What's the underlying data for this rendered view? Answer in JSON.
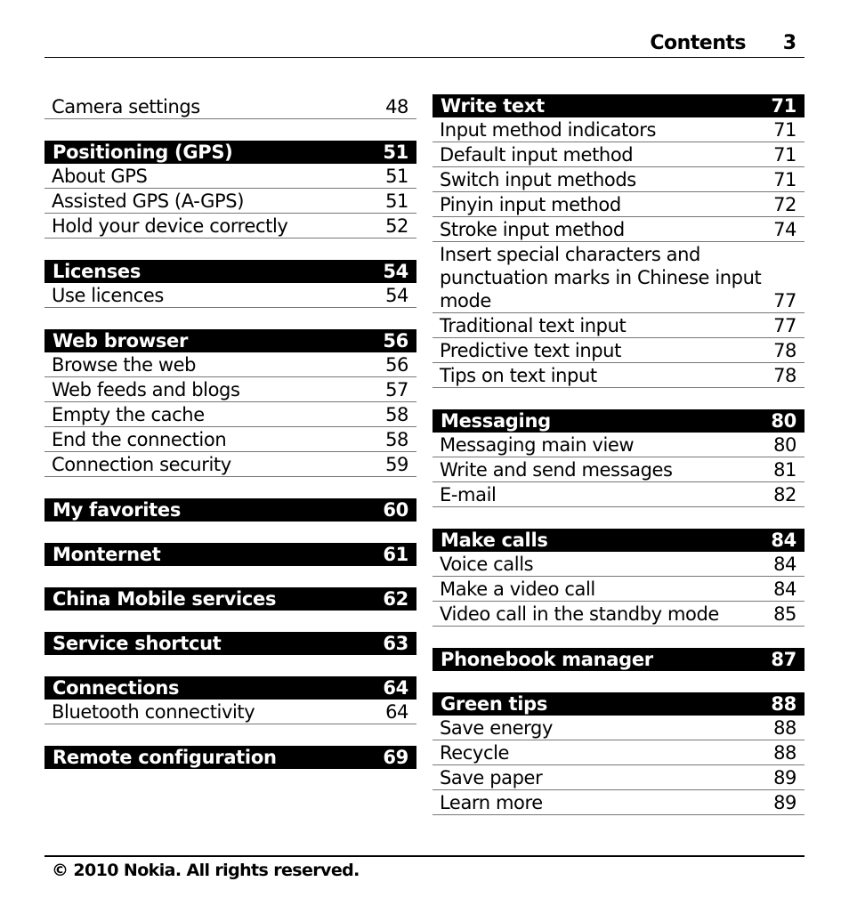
{
  "header": {
    "title": "Contents",
    "page": "3"
  },
  "left": [
    {
      "heading": null,
      "entries": [
        {
          "label": "Camera settings",
          "page": "48"
        }
      ]
    },
    {
      "heading": {
        "label": "Positioning (GPS)",
        "page": "51"
      },
      "entries": [
        {
          "label": "About GPS",
          "page": "51"
        },
        {
          "label": "Assisted GPS (A-GPS)",
          "page": "51"
        },
        {
          "label": "Hold your device correctly",
          "page": "52"
        }
      ]
    },
    {
      "heading": {
        "label": "Licenses",
        "page": "54"
      },
      "entries": [
        {
          "label": "Use licences",
          "page": "54"
        }
      ]
    },
    {
      "heading": {
        "label": "Web browser",
        "page": "56"
      },
      "entries": [
        {
          "label": "Browse the web",
          "page": "56"
        },
        {
          "label": "Web feeds and blogs",
          "page": "57"
        },
        {
          "label": "Empty the cache",
          "page": "58"
        },
        {
          "label": "End the connection",
          "page": "58"
        },
        {
          "label": "Connection security",
          "page": "59"
        }
      ]
    },
    {
      "heading": {
        "label": "My favorites",
        "page": "60"
      },
      "entries": []
    },
    {
      "heading": {
        "label": "Monternet",
        "page": "61"
      },
      "entries": []
    },
    {
      "heading": {
        "label": "China Mobile services",
        "page": "62"
      },
      "entries": []
    },
    {
      "heading": {
        "label": "Service shortcut",
        "page": "63"
      },
      "entries": []
    },
    {
      "heading": {
        "label": "Connections",
        "page": "64"
      },
      "entries": [
        {
          "label": "Bluetooth connectivity",
          "page": "64"
        }
      ]
    },
    {
      "heading": {
        "label": "Remote configuration",
        "page": "69"
      },
      "entries": []
    }
  ],
  "right": [
    {
      "heading": {
        "label": "Write text",
        "page": "71"
      },
      "entries": [
        {
          "label": "Input method indicators",
          "page": "71"
        },
        {
          "label": "Default input method",
          "page": "71"
        },
        {
          "label": "Switch input methods",
          "page": "71"
        },
        {
          "label": "Pinyin input method",
          "page": "72"
        },
        {
          "label": "Stroke input method",
          "page": "74"
        },
        {
          "label": "Insert special characters and punctuation marks in Chinese input mode",
          "page": "77"
        },
        {
          "label": "Traditional text input",
          "page": "77"
        },
        {
          "label": "Predictive text input",
          "page": "78"
        },
        {
          "label": "Tips on text input",
          "page": "78"
        }
      ]
    },
    {
      "heading": {
        "label": "Messaging",
        "page": "80"
      },
      "entries": [
        {
          "label": "Messaging main view",
          "page": "80"
        },
        {
          "label": "Write and send messages",
          "page": "81"
        },
        {
          "label": "E-mail",
          "page": "82"
        }
      ]
    },
    {
      "heading": {
        "label": "Make calls",
        "page": "84"
      },
      "entries": [
        {
          "label": "Voice calls",
          "page": "84"
        },
        {
          "label": "Make a video call",
          "page": "84"
        },
        {
          "label": "Video call in the standby mode",
          "page": "85"
        }
      ]
    },
    {
      "heading": {
        "label": "Phonebook manager",
        "page": "87"
      },
      "entries": []
    },
    {
      "heading": {
        "label": "Green tips",
        "page": "88"
      },
      "entries": [
        {
          "label": "Save energy",
          "page": "88"
        },
        {
          "label": "Recycle",
          "page": "88"
        },
        {
          "label": "Save paper",
          "page": "89"
        },
        {
          "label": "Learn more",
          "page": "89"
        }
      ]
    }
  ],
  "footer": {
    "text": "© 2010 Nokia. All rights reserved."
  }
}
